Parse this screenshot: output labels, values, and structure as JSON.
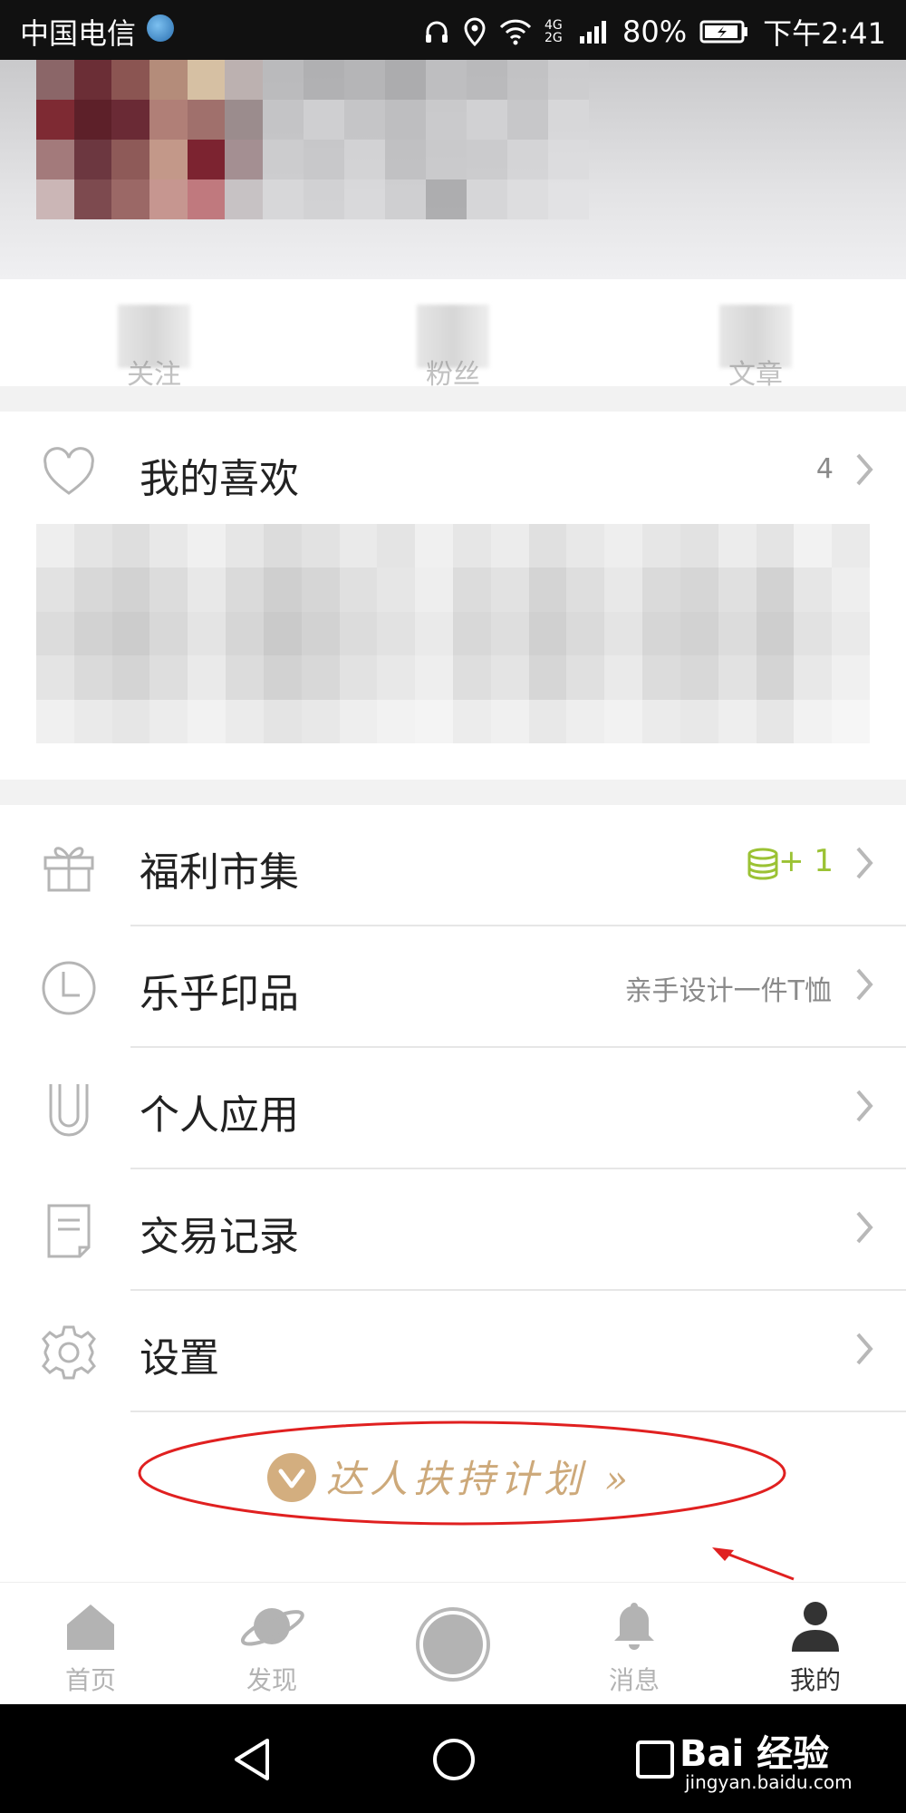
{
  "status_bar": {
    "carrier": "中国电信",
    "network_label": "4G 2G",
    "battery": "80%",
    "time": "下午2:41"
  },
  "profile": {
    "stats": [
      {
        "label": "关注"
      },
      {
        "label": "粉丝"
      },
      {
        "label": "文章"
      }
    ]
  },
  "favorites": {
    "title": "我的喜欢",
    "count": "4"
  },
  "menu": [
    {
      "id": "welfare",
      "title": "福利市集",
      "meta": "+ 1",
      "icon": "gift-icon",
      "meta_icon": "coins-icon",
      "meta_color": "#9bc234"
    },
    {
      "id": "print",
      "title": "乐乎印品",
      "meta": "亲手设计一件T恤",
      "icon": "clock-icon"
    },
    {
      "id": "apps",
      "title": "个人应用",
      "meta": "",
      "icon": "u-shape-icon"
    },
    {
      "id": "trades",
      "title": "交易记录",
      "meta": "",
      "icon": "document-icon"
    },
    {
      "id": "settings",
      "title": "设置",
      "meta": "",
      "icon": "gear-icon"
    }
  ],
  "promo": {
    "text": "达人扶持计划 »",
    "accent": "#d3ae7f",
    "annotation_color": "#e02020"
  },
  "tab_bar": {
    "tabs": [
      {
        "label": "首页",
        "icon": "home-icon"
      },
      {
        "label": "发现",
        "icon": "planet-icon"
      },
      {
        "label": "",
        "icon": "publish-circle-icon"
      },
      {
        "label": "消息",
        "icon": "bell-icon"
      },
      {
        "label": "我的",
        "icon": "person-icon",
        "active": true
      }
    ]
  },
  "watermark": {
    "brand": "Bai 经验",
    "url": "jingyan.baidu.com"
  }
}
